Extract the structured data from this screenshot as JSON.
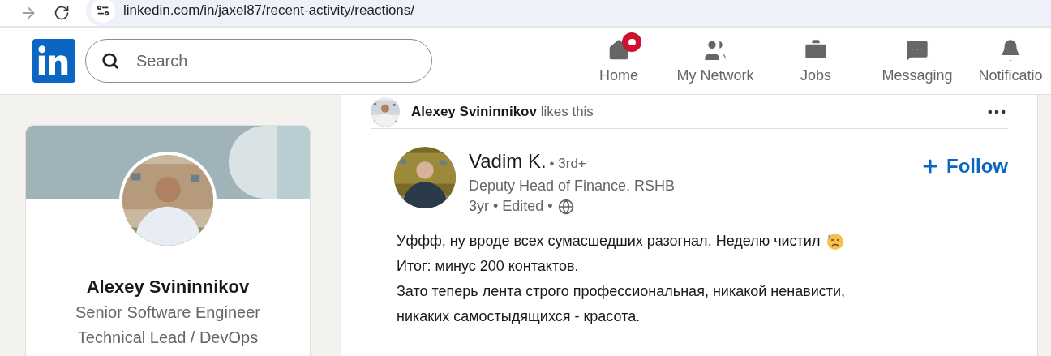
{
  "browser": {
    "url": "linkedin.com/in/jaxel87/recent-activity/reactions/",
    "forward_disabled": true
  },
  "header": {
    "search": {
      "placeholder": "Search"
    },
    "nav": [
      {
        "label": "Home",
        "kind": "home",
        "notification": true
      },
      {
        "label": "My Network",
        "kind": "network",
        "notification": false
      },
      {
        "label": "Jobs",
        "kind": "jobs",
        "notification": false
      },
      {
        "label": "Messaging",
        "kind": "messaging",
        "notification": false
      },
      {
        "label": "Notificatio",
        "kind": "notifications",
        "notification": false
      }
    ]
  },
  "profile_card": {
    "name": "Alexey Svininnikov",
    "headline": [
      "Senior Software Engineer",
      "Technical Lead / DevOps"
    ]
  },
  "post": {
    "reaction": {
      "actor": "Alexey Svininnikov",
      "text": "likes this"
    },
    "author": {
      "name": "Vadim K.",
      "degree": "• 3rd+",
      "title": "Deputy Head of Finance, RSHB",
      "meta": "3yr • Edited •"
    },
    "follow": "Follow",
    "body": [
      "Уффф, ну вроде всех сумасшедших разогнал. Неделю чистил",
      "Итог: минус 200 контактов.",
      "Зато теперь лента строго профессиональная, никакой ненависти,",
      "никаких самостыдящихся - красота."
    ]
  }
}
